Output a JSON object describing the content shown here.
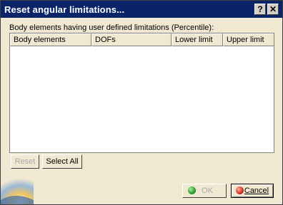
{
  "window": {
    "title": "Reset angular limitations...",
    "help_glyph": "?",
    "close_glyph": "✕"
  },
  "list": {
    "heading": "Body elements having user defined limitations (Percentile):",
    "columns": [
      "Body elements",
      "DOFs",
      "Lower limit",
      "Upper limit"
    ],
    "rows": []
  },
  "buttons": {
    "reset": "Reset",
    "select_all": "Select All",
    "ok": "OK",
    "cancel": "Cancel"
  },
  "colors": {
    "titlebar": "#0A246A",
    "dialog_bg": "#F0E8D0",
    "disabled_text": "#A8A8A8"
  },
  "icons": {
    "ok": "green-dot-icon",
    "cancel": "red-dot-icon",
    "logo": "catia-logo-icon"
  },
  "state": {
    "reset_enabled": false,
    "ok_enabled": false
  }
}
